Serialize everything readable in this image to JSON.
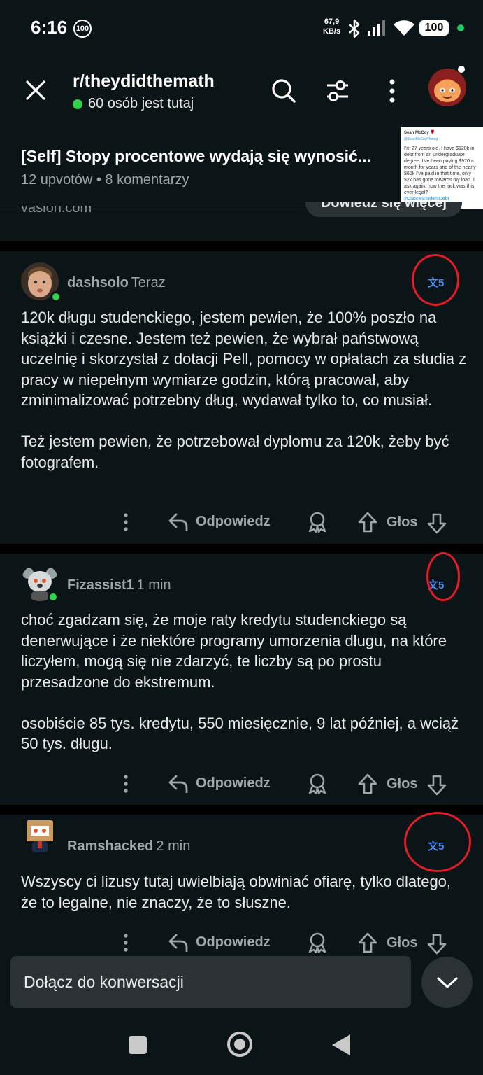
{
  "status_bar": {
    "time": "6:16",
    "notif_badge": "100",
    "speed_value": "67,9",
    "speed_unit": "KB/s",
    "battery": "100"
  },
  "header": {
    "subreddit": "r/theydidthemath",
    "online_text": "60 osób jest tutaj"
  },
  "post": {
    "title": "[Self] Stopy procentowe wydają się wynosić...",
    "meta": "12 upvotów  •  8 komentarzy",
    "ad_domain": "vasion.com",
    "learn_more": "Dowiedz się więcej",
    "thumbnail": {
      "name": "Sean McCoy 🌹",
      "handle": "@SeanMcCoyPhotog",
      "text": "I'm 27 years old, I have $120k in debt from an undergraduate degree. I've been paying $970 a month for years and of the nearly $60k I've paid in that time, only $2k has gone towards my loan. I ask again: how the fuck was this ever legal?",
      "hashtag": "#CancelStudentDebt"
    }
  },
  "comments": [
    {
      "user": "dashsolo",
      "time": "Teraz",
      "translate_label": "文5",
      "paragraphs": [
        "120k długu studenckiego, jestem pewien, że 100% poszło na książki i czesne. Jestem też pewien, że wybrał państwową uczelnię i skorzystał z dotacji Pell, pomocy w opłatach za studia z pracy w niepełnym wymiarze godzin, którą pracował, aby zminimalizować potrzebny dług, wydawał tylko to, co musiał.",
        "Też jestem pewien, że potrzebował dyplomu za 120k, żeby być fotografem."
      ],
      "reply": "Odpowiedz",
      "vote": "Głos"
    },
    {
      "user": "Fizassist1",
      "time": "1 min",
      "translate_label": "文5",
      "paragraphs": [
        "choć zgadzam się, że moje raty kredytu studenckiego są denerwujące i że niektóre programy umorzenia długu, na które liczyłem, mogą się nie zdarzyć, te liczby są po prostu przesadzone do ekstremum.",
        "osobiście 85 tys. kredytu, 550 miesięcznie, 9 lat później, a wciąż 50 tys. długu."
      ],
      "reply": "Odpowiedz",
      "vote": "Głos"
    },
    {
      "user": "Ramshacked",
      "time": "2 min",
      "translate_label": "文5",
      "paragraphs": [
        "Wszyscy ci lizusy tutaj uwielbiają obwiniać ofiarę, tylko dlatego, że to legalne, nie znaczy, że to słuszne."
      ],
      "reply": "Odpowiedz",
      "vote": "Głos"
    }
  ],
  "composer": {
    "placeholder": "Dołącz do konwersacji"
  },
  "colors": {
    "background": "#0b1416",
    "online_green": "#2fd24a",
    "annotation_red": "#e11d2a",
    "translate_blue": "#4b8cf5"
  }
}
